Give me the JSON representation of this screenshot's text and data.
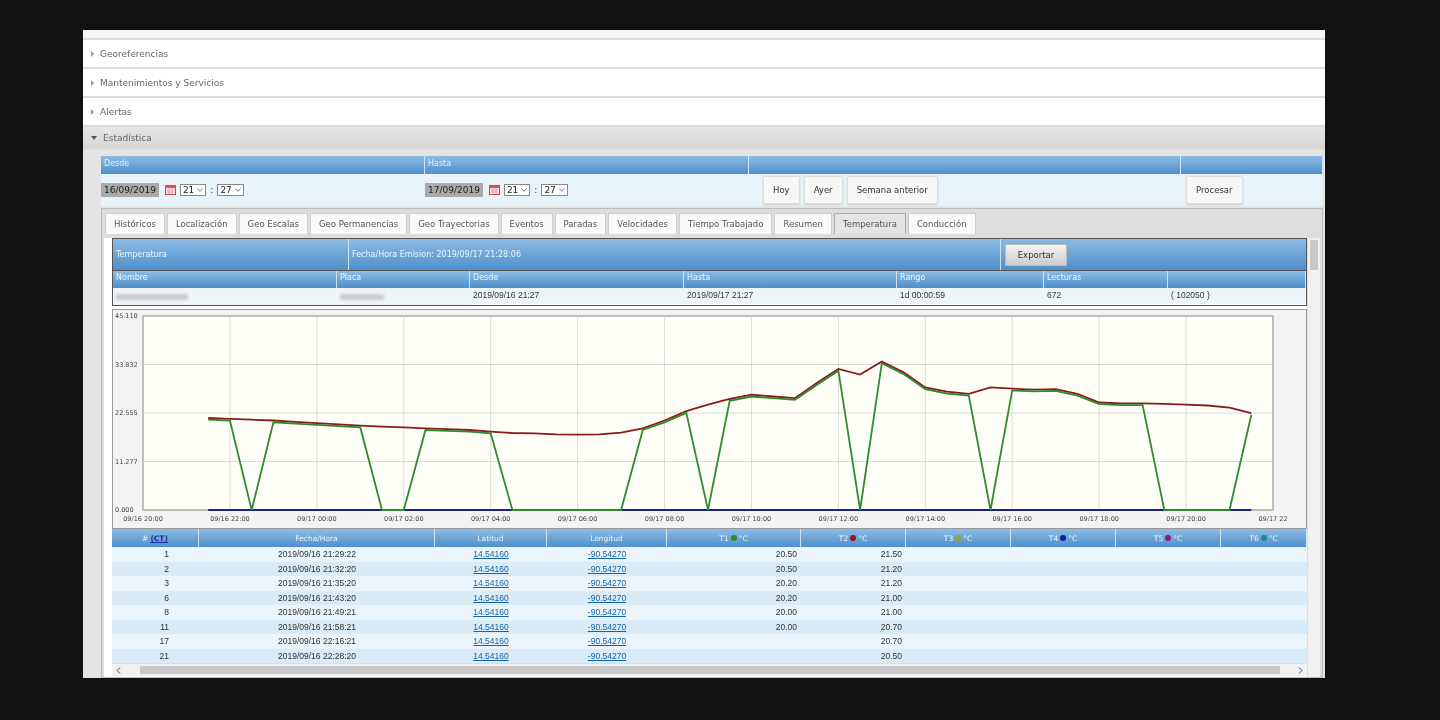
{
  "accordion": [
    {
      "label": "Georeferencias",
      "expanded": false
    },
    {
      "label": "Mantenimientos y Servicios",
      "expanded": false
    },
    {
      "label": "Alertas",
      "expanded": false
    },
    {
      "label": "Estadística",
      "expanded": true
    }
  ],
  "filter": {
    "headers": [
      "Desde",
      "Hasta"
    ],
    "from": {
      "date": "16/09/2019",
      "hour": "21",
      "separator": ":",
      "minute": "27"
    },
    "to": {
      "date": "17/09/2019",
      "hour": "21",
      "separator": ":",
      "minute": "27"
    },
    "quick_buttons": [
      "Hoy",
      "Ayer",
      "Semana anterior"
    ],
    "process_button": "Procesar"
  },
  "tabs": [
    {
      "label": "Históricos",
      "selected": false
    },
    {
      "label": "Localización",
      "selected": false
    },
    {
      "label": "Geo Escalas",
      "selected": false
    },
    {
      "label": "Geo Permanencias",
      "selected": false
    },
    {
      "label": "Geo Trayectorias",
      "selected": false
    },
    {
      "label": "Eventos",
      "selected": false
    },
    {
      "label": "Paradas",
      "selected": false
    },
    {
      "label": "Velocidades",
      "selected": false
    },
    {
      "label": "Tiempo Trabajado",
      "selected": false
    },
    {
      "label": "Resumen",
      "selected": false
    },
    {
      "label": "Temperatura",
      "selected": true
    },
    {
      "label": "Conducción",
      "selected": false
    }
  ],
  "report": {
    "title": "Temperatura",
    "emission": "Fecha/Hora Emision: 2019/09/17 21:28:06",
    "export_button": "Exportar",
    "info_columns": [
      "Nombre",
      "Placa",
      "Desde",
      "Hasta",
      "Rango",
      "Lecturas"
    ],
    "info_values": {
      "desde": "2019/09/16 21:27",
      "hasta": "2019/09/17 21:27",
      "rango": "1d 00:00:59",
      "lecturas": "672",
      "extra": "( 102050 )"
    }
  },
  "chart_data": {
    "type": "line",
    "categories": [
      "09/16 20:00",
      null,
      null,
      null,
      "09/16 22:00",
      null,
      null,
      null,
      "09/17 00:00",
      null,
      null,
      null,
      "09/17 02:00",
      null,
      null,
      null,
      "09/17 04:00",
      null,
      null,
      null,
      "09/17 06:00",
      null,
      null,
      null,
      "09/17 08:00",
      null,
      null,
      null,
      "09/17 10:00",
      null,
      null,
      null,
      "09/17 12:00",
      null,
      null,
      null,
      "09/17 14:00",
      null,
      null,
      null,
      "09/17 16:00",
      null,
      null,
      null,
      "09/17 18:00",
      null,
      null,
      null,
      "09/17 20:00",
      null,
      null,
      null,
      "09/17 22"
    ],
    "series": [
      {
        "color": "#1a237e",
        "values": [
          null,
          null,
          null,
          0,
          0,
          0,
          0,
          0,
          0,
          0,
          0,
          0,
          0,
          0,
          0,
          0,
          0,
          0,
          0,
          0,
          0,
          0,
          0,
          0,
          0,
          0,
          0,
          0,
          0,
          0,
          0,
          0,
          0,
          0,
          0,
          0,
          0,
          0,
          0,
          0,
          0,
          0,
          0,
          0,
          0,
          0,
          0,
          0,
          0,
          0,
          0,
          0,
          null
        ]
      },
      {
        "color": "#8b1a1a",
        "values": [
          null,
          null,
          null,
          21.4,
          21.2,
          21.0,
          20.8,
          20.5,
          20.2,
          19.9,
          19.6,
          19.4,
          19.2,
          19.0,
          18.8,
          18.6,
          18.2,
          17.9,
          17.8,
          17.6,
          17.5,
          17.6,
          18.0,
          19.0,
          20.8,
          23.0,
          24.5,
          25.8,
          26.8,
          26.4,
          26.0,
          29.5,
          32.8,
          31.5,
          34.5,
          32.0,
          28.5,
          27.5,
          27.0,
          28.5,
          28.2,
          28.0,
          28.1,
          27.0,
          25.0,
          24.8,
          24.8,
          24.7,
          24.5,
          24.3,
          23.8,
          22.5,
          null
        ]
      },
      {
        "color": "#2e8b2e",
        "values": [
          null,
          null,
          null,
          21.0,
          20.8,
          0,
          20.4,
          20.1,
          19.8,
          19.5,
          19.2,
          0,
          0,
          18.6,
          18.4,
          18.2,
          17.8,
          0,
          0,
          0,
          0,
          0,
          0,
          18.6,
          20.4,
          22.6,
          0,
          25.4,
          26.4,
          26.0,
          25.6,
          29.1,
          32.4,
          0,
          34.1,
          31.6,
          28.1,
          27.1,
          26.6,
          0,
          27.8,
          27.6,
          27.7,
          26.6,
          24.6,
          24.4,
          24.4,
          0,
          0,
          0,
          0,
          22.1,
          null
        ]
      }
    ],
    "grid": true,
    "ylim": [
      0,
      45.11
    ],
    "yticks": [
      {
        "value": 0,
        "label": "0.000"
      },
      {
        "value": 11.277,
        "label": "11.277"
      },
      {
        "value": 22.555,
        "label": "22.555"
      },
      {
        "value": 33.832,
        "label": "33.832"
      },
      {
        "value": 45.11,
        "label": "45.110"
      }
    ]
  },
  "table": {
    "first_column": {
      "label": "#",
      "link": "(CT)"
    },
    "columns": [
      {
        "kind": "plain",
        "label": "Fecha/Hora"
      },
      {
        "kind": "plain",
        "label": "Latitud"
      },
      {
        "kind": "plain",
        "label": "Longitud"
      },
      {
        "kind": "sensor",
        "label": "T1",
        "unit": "°C",
        "color": "#2e8b2e"
      },
      {
        "kind": "sensor",
        "label": "T2",
        "unit": "°C",
        "color": "#8b1a1a"
      },
      {
        "kind": "sensor",
        "label": "T3",
        "unit": "°C",
        "color": "#a0a030"
      },
      {
        "kind": "sensor",
        "label": "T4",
        "unit": "°C",
        "color": "#1a1aa0"
      },
      {
        "kind": "sensor",
        "label": "T5",
        "unit": "°C",
        "color": "#8a1a8a"
      },
      {
        "kind": "sensor",
        "label": "T6",
        "unit": "°C",
        "color": "#1a8a8a"
      }
    ],
    "rows": [
      {
        "n": "1",
        "datetime": "2019/09/16 21:29:22",
        "lat": "14.54160",
        "lon": "-90.54270",
        "t1": "20.50",
        "t2": "21.50"
      },
      {
        "n": "2",
        "datetime": "2019/09/16 21:32:20",
        "lat": "14.54160",
        "lon": "-90.54270",
        "t1": "20.50",
        "t2": "21.20"
      },
      {
        "n": "3",
        "datetime": "2019/09/16 21:35:20",
        "lat": "14.54160",
        "lon": "-90.54270",
        "t1": "20.20",
        "t2": "21.20"
      },
      {
        "n": "6",
        "datetime": "2019/09/16 21:43:20",
        "lat": "14.54160",
        "lon": "-90.54270",
        "t1": "20.20",
        "t2": "21.00"
      },
      {
        "n": "8",
        "datetime": "2019/09/16 21:49:21",
        "lat": "14.54160",
        "lon": "-90.54270",
        "t1": "20.00",
        "t2": "21.00"
      },
      {
        "n": "11",
        "datetime": "2019/09/16 21:58:21",
        "lat": "14.54160",
        "lon": "-90.54270",
        "t1": "20.00",
        "t2": "20.70"
      },
      {
        "n": "17",
        "datetime": "2019/09/16 22:16:21",
        "lat": "14.54160",
        "lon": "-90.54270",
        "t2": "20.70"
      },
      {
        "n": "21",
        "datetime": "2019/09/16 22:28:20",
        "lat": "14.54160",
        "lon": "-90.54270",
        "t2": "20.50"
      }
    ]
  }
}
